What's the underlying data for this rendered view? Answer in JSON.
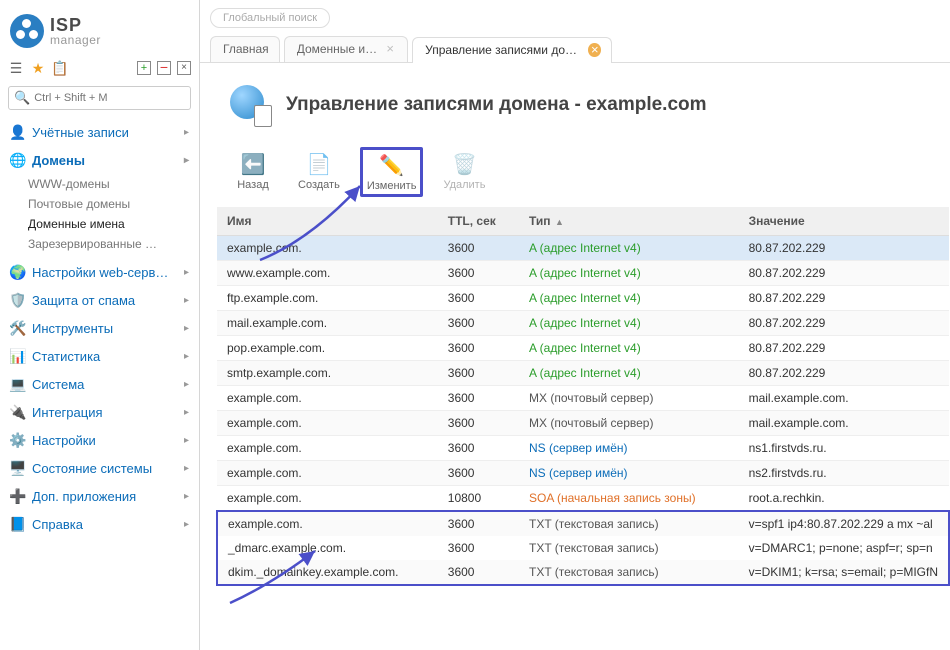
{
  "logo": {
    "brand": "ISP",
    "sub": "manager"
  },
  "search_placeholder": "Ctrl + Shift + M",
  "global_search": "Глобальный поиск",
  "nav": [
    {
      "id": "accounts",
      "label": "Учётные записи",
      "icon": "👤"
    },
    {
      "id": "domains",
      "label": "Домены",
      "icon": "🌐",
      "bold": true,
      "expanded": true,
      "children": [
        {
          "id": "www",
          "label": "WWW-домены"
        },
        {
          "id": "mail",
          "label": "Почтовые домены"
        },
        {
          "id": "names",
          "label": "Доменные имена",
          "active": true
        },
        {
          "id": "reserved",
          "label": "Зарезервированные …"
        }
      ]
    },
    {
      "id": "websettings",
      "label": "Настройки web-серв…",
      "icon": "🌍"
    },
    {
      "id": "antispam",
      "label": "Защита от спама",
      "icon": "🛡️"
    },
    {
      "id": "tools",
      "label": "Инструменты",
      "icon": "🛠️"
    },
    {
      "id": "stats",
      "label": "Статистика",
      "icon": "📊"
    },
    {
      "id": "system",
      "label": "Система",
      "icon": "💻"
    },
    {
      "id": "integration",
      "label": "Интеграция",
      "icon": "🔌"
    },
    {
      "id": "settings",
      "label": "Настройки",
      "icon": "⚙️"
    },
    {
      "id": "state",
      "label": "Состояние системы",
      "icon": "🖥️"
    },
    {
      "id": "extra",
      "label": "Доп. приложения",
      "icon": "➕"
    },
    {
      "id": "help",
      "label": "Справка",
      "icon": "📘"
    }
  ],
  "tabs": [
    {
      "id": "main",
      "label": "Главная",
      "closeable": false
    },
    {
      "id": "dnames",
      "label": "Доменные и…",
      "closeable": true
    },
    {
      "id": "records",
      "label": "Управление записями домен…",
      "closeable": true,
      "active": true
    }
  ],
  "page_title": "Управление записями домена - example.com",
  "actions": [
    {
      "id": "back",
      "label": "Назад",
      "icon": "⬅️"
    },
    {
      "id": "create",
      "label": "Создать",
      "icon": "📄"
    },
    {
      "id": "edit",
      "label": "Изменить",
      "icon": "✏️",
      "highlighted": true
    },
    {
      "id": "delete",
      "label": "Удалить",
      "icon": "🗑️",
      "disabled": true
    }
  ],
  "columns": {
    "name": "Имя",
    "ttl": "TTL, сек",
    "type": "Тип",
    "value": "Значение"
  },
  "rows": [
    {
      "name": "example.com.",
      "ttl": "3600",
      "type": "A (адрес Internet v4)",
      "tclass": "type-a",
      "value": "80.87.202.229",
      "selected": true
    },
    {
      "name": "www.example.com.",
      "ttl": "3600",
      "type": "A (адрес Internet v4)",
      "tclass": "type-a",
      "value": "80.87.202.229"
    },
    {
      "name": "ftp.example.com.",
      "ttl": "3600",
      "type": "A (адрес Internet v4)",
      "tclass": "type-a",
      "value": "80.87.202.229"
    },
    {
      "name": "mail.example.com.",
      "ttl": "3600",
      "type": "A (адрес Internet v4)",
      "tclass": "type-a",
      "value": "80.87.202.229"
    },
    {
      "name": "pop.example.com.",
      "ttl": "3600",
      "type": "A (адрес Internet v4)",
      "tclass": "type-a",
      "value": "80.87.202.229"
    },
    {
      "name": "smtp.example.com.",
      "ttl": "3600",
      "type": "A (адрес Internet v4)",
      "tclass": "type-a",
      "value": "80.87.202.229"
    },
    {
      "name": "example.com.",
      "ttl": "3600",
      "type": "MX (почтовый сервер)",
      "tclass": "type-mx",
      "value": "mail.example.com."
    },
    {
      "name": "example.com.",
      "ttl": "3600",
      "type": "MX (почтовый сервер)",
      "tclass": "type-mx",
      "value": "mail.example.com."
    },
    {
      "name": "example.com.",
      "ttl": "3600",
      "type": "NS (сервер имён)",
      "tclass": "type-ns",
      "value": "ns1.firstvds.ru."
    },
    {
      "name": "example.com.",
      "ttl": "3600",
      "type": "NS (сервер имён)",
      "tclass": "type-ns",
      "value": "ns2.firstvds.ru."
    },
    {
      "name": "example.com.",
      "ttl": "10800",
      "type": "SOA (начальная запись зоны)",
      "tclass": "type-soa",
      "value": "root.a.rechkin."
    },
    {
      "name": "example.com.",
      "ttl": "3600",
      "type": "TXT (текстовая запись)",
      "tclass": "type-txt",
      "value": "v=spf1 ip4:80.87.202.229 a mx ~al",
      "boxstart": true
    },
    {
      "name": "_dmarc.example.com.",
      "ttl": "3600",
      "type": "TXT (текстовая запись)",
      "tclass": "type-txt",
      "value": "v=DMARC1; p=none; aspf=r; sp=n"
    },
    {
      "name": "dkim._domainkey.example.com.",
      "ttl": "3600",
      "type": "TXT (текстовая запись)",
      "tclass": "type-txt",
      "value": "v=DKIM1; k=rsa; s=email; p=MIGfN",
      "boxend": true
    }
  ]
}
